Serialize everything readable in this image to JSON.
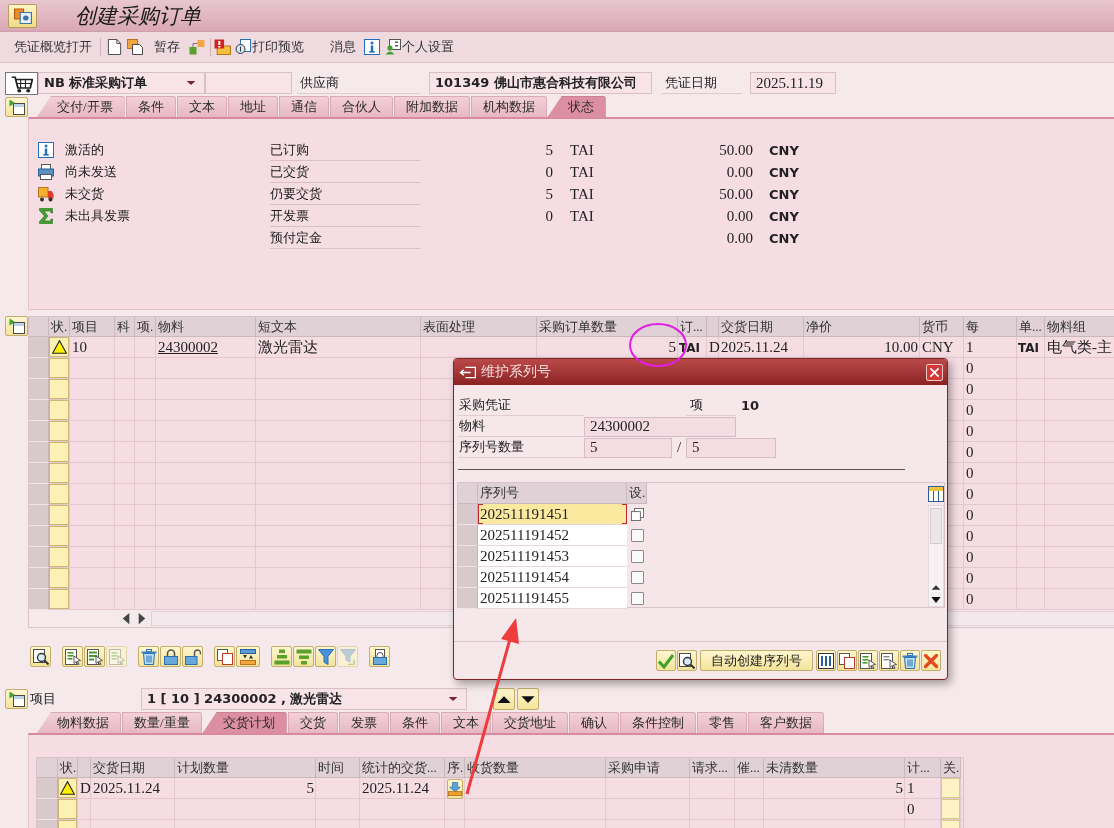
{
  "title_bar": {
    "title": "创建采购订单"
  },
  "toolbar": {
    "overview": "凭证概览打开",
    "hold": "暂存",
    "print_preview": "打印预览",
    "messages": "消息",
    "personal_settings": "个人设置"
  },
  "header": {
    "order_type": "NB 标准采购订单",
    "supplier_label": "供应商",
    "supplier": "101349 佛山市惠合科技有限公司",
    "date_label": "凭证日期",
    "date": "2025.11.19"
  },
  "header_tabs": [
    {
      "label": "交付/开票",
      "selected": false
    },
    {
      "label": "条件",
      "selected": false
    },
    {
      "label": "文本",
      "selected": false
    },
    {
      "label": "地址",
      "selected": false
    },
    {
      "label": "通信",
      "selected": false
    },
    {
      "label": "合伙人",
      "selected": false
    },
    {
      "label": "附加数据",
      "selected": false
    },
    {
      "label": "机构数据",
      "selected": false
    },
    {
      "label": "状态",
      "selected": true
    }
  ],
  "status_panel": {
    "statuses": [
      {
        "kind": "active",
        "label": "激活的"
      },
      {
        "kind": "output",
        "label": "尚未发送"
      },
      {
        "kind": "delivery",
        "label": "未交货"
      },
      {
        "kind": "invoice",
        "label": "未出具发票"
      }
    ],
    "figures": [
      {
        "label": "已订购",
        "quantity": "5",
        "unit": "TAI",
        "amount": "50.00",
        "currency": "CNY"
      },
      {
        "label": "已交货",
        "quantity": "0",
        "unit": "TAI",
        "amount": "0.00",
        "currency": "CNY"
      },
      {
        "label": "仍要交货",
        "quantity": "5",
        "unit": "TAI",
        "amount": "50.00",
        "currency": "CNY"
      },
      {
        "label": "开发票",
        "quantity": "0",
        "unit": "TAI",
        "amount": "0.00",
        "currency": "CNY"
      },
      {
        "label": "预付定金",
        "amount": "0.00",
        "currency": "CNY"
      }
    ]
  },
  "items_table": {
    "columns": [
      "状.",
      "项目",
      "科",
      "项.",
      "物料",
      "短文本",
      "表面处理",
      "采购订单数量",
      "订...",
      "交货日期",
      "净价",
      "货币",
      "每",
      "单...",
      "物料组"
    ],
    "rows": [
      {
        "warning": true,
        "item": "10",
        "material": "24300002",
        "short_text": "激光雷达",
        "quantity": "5",
        "order_unit": "TAI",
        "column_10": "D",
        "delivery_date": "2025.11.24",
        "net_price": "10.00",
        "currency": "CNY",
        "per": "1",
        "price_unit": "TAI",
        "material_group": "电气类-主"
      },
      {
        "warning": false,
        "per": "0"
      },
      {
        "warning": false,
        "per": "0"
      },
      {
        "warning": false,
        "per": "0"
      },
      {
        "warning": false,
        "per": "0"
      },
      {
        "warning": false,
        "per": "0"
      },
      {
        "warning": false,
        "per": "0"
      },
      {
        "warning": false,
        "per": "0"
      },
      {
        "warning": false,
        "per": "0"
      },
      {
        "warning": false,
        "per": "0"
      },
      {
        "warning": false,
        "per": "0"
      },
      {
        "warning": false,
        "per": "0"
      },
      {
        "warning": false,
        "per": "0"
      }
    ]
  },
  "item_toolbar": {
    "buttons": [
      {
        "disabled": false
      },
      {
        "disabled": false
      },
      {
        "disabled": false
      },
      {
        "disabled": true
      },
      {
        "disabled": false
      },
      {
        "disabled": false
      },
      {
        "disabled": false
      },
      {
        "disabled": false
      },
      {
        "disabled": false
      },
      {
        "disabled": false
      },
      {
        "disabled": false
      },
      {
        "disabled": false
      },
      {
        "disabled": true
      },
      {
        "disabled": false
      }
    ]
  },
  "item_selector": {
    "label": "项目",
    "value": "1 [ 10 ] 24300002 , 激光雷达"
  },
  "item_tabs": [
    {
      "label": "物料数据",
      "selected": false
    },
    {
      "label": "数量/重量",
      "selected": false
    },
    {
      "label": "交货计划",
      "selected": true
    },
    {
      "label": "交货",
      "selected": false
    },
    {
      "label": "发票",
      "selected": false
    },
    {
      "label": "条件",
      "selected": false
    },
    {
      "label": "文本",
      "selected": false
    },
    {
      "label": "交货地址",
      "selected": false
    },
    {
      "label": "确认",
      "selected": false
    },
    {
      "label": "条件控制",
      "selected": false
    },
    {
      "label": "零售",
      "selected": false
    },
    {
      "label": "客户数据",
      "selected": false
    }
  ],
  "schedule_table": {
    "columns": [
      "状.",
      "交货日期",
      "计划数量",
      "时间",
      "统计的交货...",
      "序.",
      "收货数量",
      "采购申请",
      "请求...",
      "催...",
      "未清数量",
      "计...",
      "关."
    ],
    "rows": [
      {
        "warning": true,
        "column_3": "D",
        "delivery_date": "2025.11.24",
        "scheduled_quantity": "5",
        "statistical_date": "2025.11.24",
        "serial_numbers": true,
        "open_quantity": "5",
        "column_14": "1"
      },
      {
        "warning": false,
        "serial_numbers": false,
        "column_14": "0"
      },
      {
        "warning": false,
        "serial_numbers": false
      }
    ]
  },
  "dialog": {
    "title": "维护系列号",
    "purchasing_doc_label": "采购凭证",
    "item_label": "项",
    "item": "10",
    "material_label": "物料",
    "material": "24300002",
    "serial_count_label": "序列号数量",
    "serial_count": "5",
    "slash": "/",
    "serial_total": "5",
    "table": {
      "columns": [
        "序列号",
        "设."
      ],
      "rows": [
        {
          "kind": "icon",
          "serial": "202511191451",
          "selected": true
        },
        {
          "kind": "checkbox",
          "serial": "202511191452",
          "selected": false,
          "checked": false
        },
        {
          "kind": "checkbox",
          "serial": "202511191453",
          "selected": false,
          "checked": false
        },
        {
          "kind": "checkbox",
          "serial": "202511191454",
          "selected": false,
          "checked": false
        },
        {
          "kind": "checkbox",
          "serial": "202511191455",
          "selected": false,
          "checked": false
        }
      ]
    },
    "buttons": [
      {
        "kind": "icon"
      },
      {
        "kind": "icon"
      },
      {
        "kind": "text",
        "label": "自动创建序列号"
      },
      {
        "kind": "icon"
      },
      {
        "kind": "icon"
      },
      {
        "kind": "icon"
      },
      {
        "kind": "icon"
      },
      {
        "kind": "icon"
      },
      {
        "kind": "icon"
      }
    ]
  }
}
